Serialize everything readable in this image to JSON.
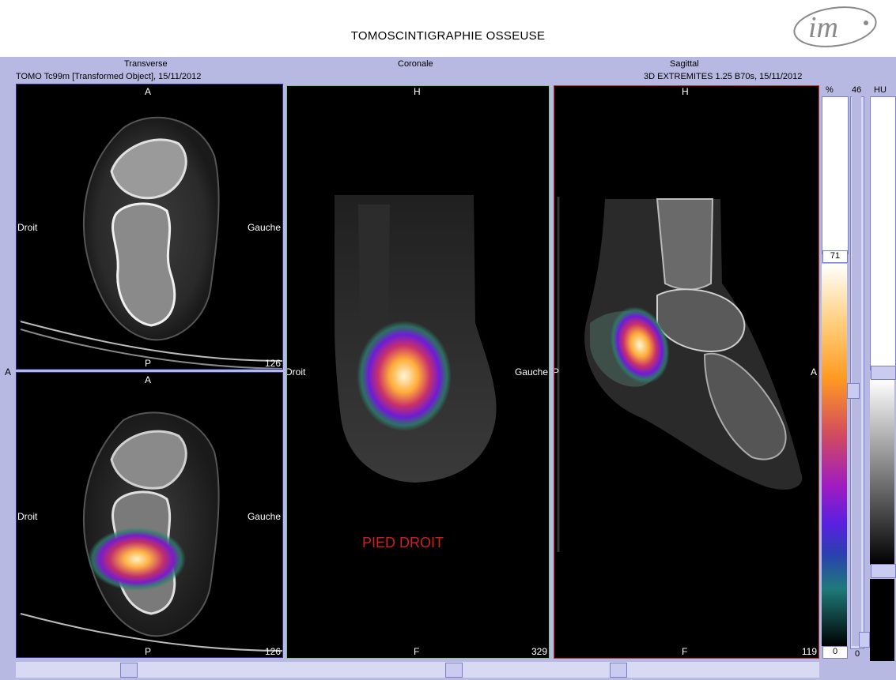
{
  "header": {
    "title": "TOMOSCINTIGRAPHIE OSSEUSE",
    "logo_text": "im"
  },
  "columns": {
    "transverse": "Transverse",
    "coronal": "Coronale",
    "sagittal": "Sagittal"
  },
  "info": {
    "left": "TOMO Tc99m [Transformed Object], 15/11/2012",
    "right": "3D EXTREMITES  1.25  B70s, 15/11/2012"
  },
  "viewports": {
    "transverse_ct": {
      "top": "A",
      "bottom": "P",
      "left": "Droit",
      "right": "Gauche",
      "slice": "126"
    },
    "transverse_fused": {
      "top": "A",
      "bottom": "P",
      "left": "Droit",
      "right": "Gauche",
      "slice": "126"
    },
    "coronal": {
      "top": "H",
      "bottom": "F",
      "left": "Droit",
      "right": "Gauche",
      "slice": "329",
      "annotation": "PIED DROIT"
    },
    "sagittal": {
      "top": "H",
      "bottom": "F",
      "left": "P",
      "right": "A",
      "slice": "119"
    }
  },
  "edge_labels": {
    "left_a": "A"
  },
  "colorbar": {
    "percent_label": "%",
    "value_label": "46",
    "hu_label": "HU",
    "upper_value": "71",
    "lower_value": "0",
    "bottom_value": "0"
  },
  "colors": {
    "background": "#b7b9e3",
    "coronal_border": "#7fc97f",
    "sagittal_border": "#c03030",
    "transverse_border": "#2d2f8f",
    "annotation": "#d41e1e"
  }
}
